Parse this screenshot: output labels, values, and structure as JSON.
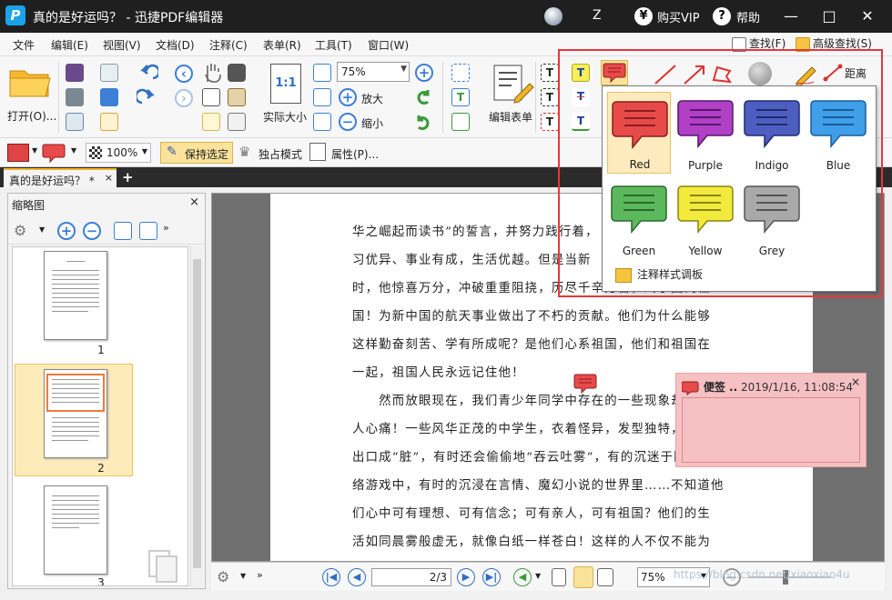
{
  "app": {
    "logo": "P",
    "title": "真的是好运吗？ - 迅捷PDF编辑器",
    "user": "Z",
    "vip_symbol": "¥",
    "vip_label": "购买VIP",
    "help_symbol": "?",
    "help_label": "帮助",
    "minimize": "—",
    "maximize": "□",
    "close": "✕"
  },
  "menu": {
    "items": [
      "文件",
      "编辑(E)",
      "视图(V)",
      "文档(D)",
      "注释(C)",
      "表单(R)",
      "工具(T)",
      "窗口(W)"
    ],
    "find_label": "查找(F)",
    "advanced_find_label": "高级查找(S)"
  },
  "ribbon": {
    "open_label": "打开(O)...",
    "actual_size_label": "实际大小",
    "actual_size_icon_text": "1:1",
    "zoom_value": "75%",
    "zoom_in_label": "放大",
    "zoom_out_label": "缩小",
    "edit_form_label": "编辑表单",
    "distance_label": "距离"
  },
  "toolbar2": {
    "percent_value": "100%",
    "keep_selected_label": "保持选定",
    "exclusive_mode_label": "独占模式",
    "properties_label": "属性(P)..."
  },
  "tab": {
    "doc_label": "真的是好运吗？ *",
    "close": "×",
    "add": "+"
  },
  "thumbnails": {
    "title": "缩略图",
    "close": "×",
    "pages": [
      "1",
      "2",
      "3"
    ],
    "selected_page": "2"
  },
  "document": {
    "paragraphs": [
      "华之崛起而读书”的誓言，并努力践行着，",
      "习优异、事业有成，生活优越。但是当新",
      "时，他惊喜万分，冲破重重阻挠，历尽千辛万苦，终于回到祖",
      "国！为新中国的航天事业做出了不朽的贡献。他们为什么能够",
      "这样勤奋刻苦、学有所成呢？是他们心系祖国，他们和祖国在",
      "一起，祖国人民永远记住他！",
      "　　然而放眼现在，我们青少年同学中存在的一些现象却很令",
      "人心痛！一些风华正茂的中学生，衣着怪异，发型独特，有时",
      "出口成“脏”，有时还会偷偷地“吞云吐雾”，有的沉迷于网",
      "络游戏中，有时的沉浸在言情、魔幻小说的世界里……不知道他",
      "们心中可有理想、可有信念；可有亲人，可有祖国？他们的生",
      "活如同晨雾般虚无，就像白纸一样苍白！这样的人不仅不能为"
    ]
  },
  "status": {
    "page_value": "2/3",
    "zoom_value": "75%",
    "watermark": "https://blog.csdn.net/xiaoxiao4u"
  },
  "sticky_note": {
    "title": "便签 ..",
    "date": "2019/1/16, 11:08:54",
    "close": "×"
  },
  "note_style_popup": {
    "colors": [
      {
        "name": "Red",
        "fill": "#e84a4a",
        "stroke": "#8a1e1e"
      },
      {
        "name": "Purple",
        "fill": "#b040c4",
        "stroke": "#5a1470"
      },
      {
        "name": "Indigo",
        "fill": "#4e5ec0",
        "stroke": "#1e2a70"
      },
      {
        "name": "Blue",
        "fill": "#3f9fe8",
        "stroke": "#1a5b99"
      },
      {
        "name": "Green",
        "fill": "#5cb85c",
        "stroke": "#2a6a2a"
      },
      {
        "name": "Yellow",
        "fill": "#f2ea3c",
        "stroke": "#8a8412"
      },
      {
        "name": "Grey",
        "fill": "#a9a9a9",
        "stroke": "#555555"
      }
    ],
    "selected": "Red",
    "footer_label": "注释样式调板"
  }
}
